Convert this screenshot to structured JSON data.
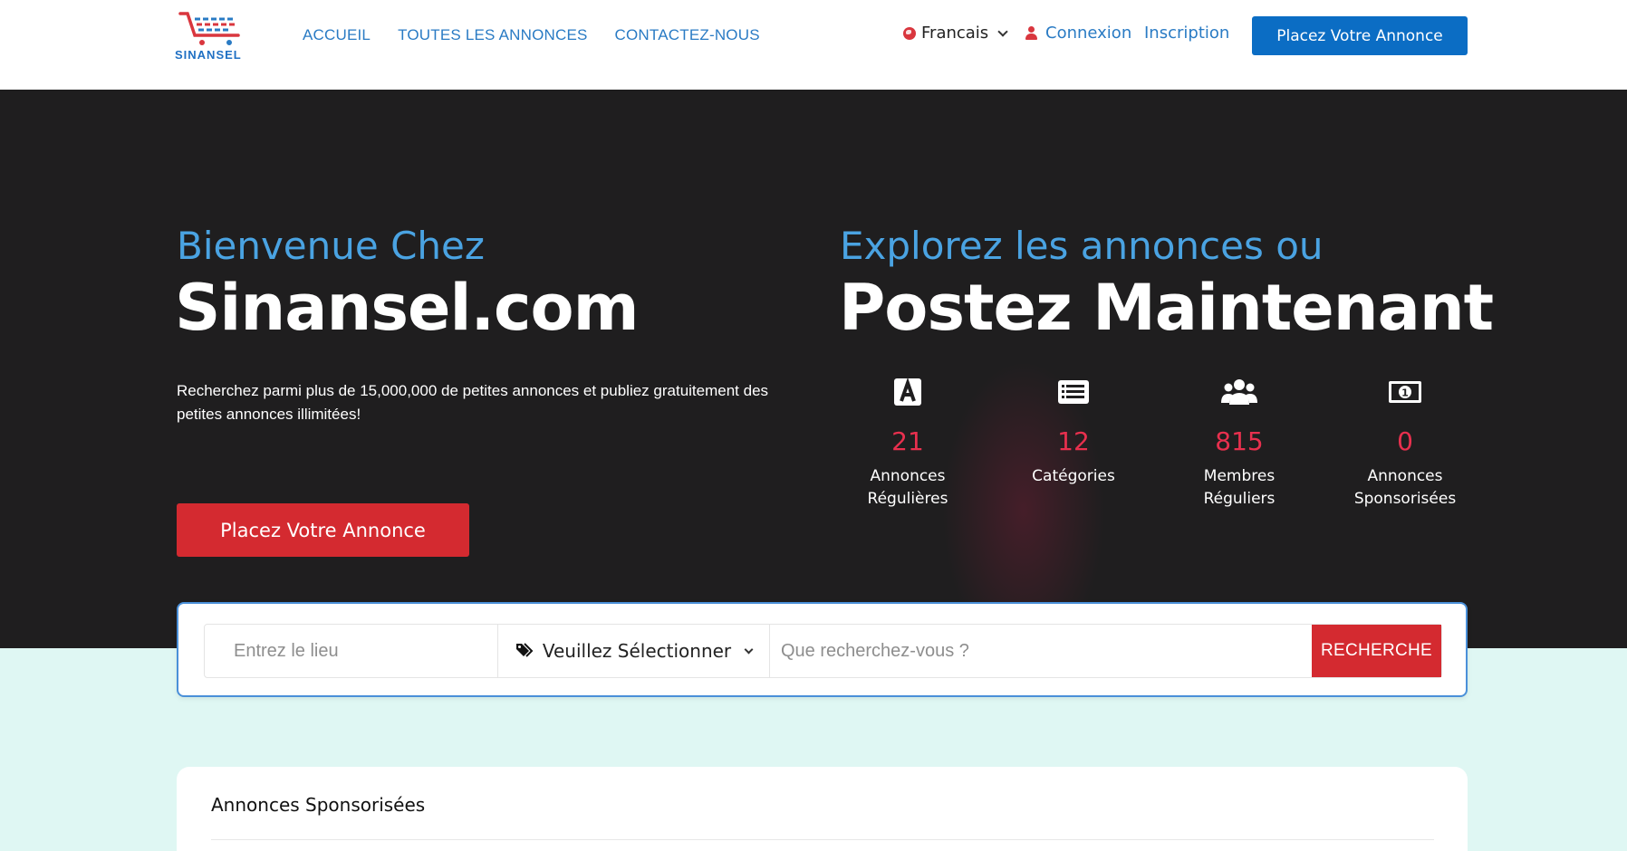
{
  "brand": {
    "logo_text": "SINANSEL",
    "cart_colors": [
      "#d9363e",
      "#2a7bc4"
    ]
  },
  "nav": {
    "items": [
      "ACCUEIL",
      "TOUTES LES ANNONCES",
      "CONTACTEZ-NOUS"
    ]
  },
  "header": {
    "language": "Francais",
    "login_label": "Connexion",
    "signup_label": "Inscription",
    "cta_label": "Placez Votre Annonce"
  },
  "hero": {
    "welcome_sub": "Bienvenue Chez",
    "welcome_title": "Sinansel.com",
    "description": "Recherchez parmi plus de 15,000,000 de petites annonces et publiez gratuitement des petites annonces illimitées!",
    "cta_label": "Placez Votre Annonce",
    "explore_sub": "Explorez les annonces ou",
    "explore_title": "Postez Maintenant",
    "stats": [
      {
        "icon": "letter-a-icon",
        "value": "21",
        "label_line1": "Annonces",
        "label_line2": "Régulières"
      },
      {
        "icon": "list-icon",
        "value": "12",
        "label_line1": "Catégories",
        "label_line2": ""
      },
      {
        "icon": "users-icon",
        "value": "815",
        "label_line1": "Membres",
        "label_line2": "Réguliers"
      },
      {
        "icon": "money-icon",
        "value": "0",
        "label_line1": "Annonces",
        "label_line2": "Sponsorisées"
      }
    ]
  },
  "search": {
    "location_placeholder": "Entrez le lieu",
    "category_label": "Veuillez Sélectionner",
    "query_placeholder": "Que recherchez-vous ?",
    "button_label": "RECHERCHE"
  },
  "sponsored": {
    "title": "Annonces Sponsorisées"
  },
  "colors": {
    "accent_blue": "#0b6dc4",
    "accent_red": "#d42a30",
    "stat_number": "#e8304e",
    "hero_bg": "#1f1e1f",
    "lower_bg": "#dff7f3"
  }
}
